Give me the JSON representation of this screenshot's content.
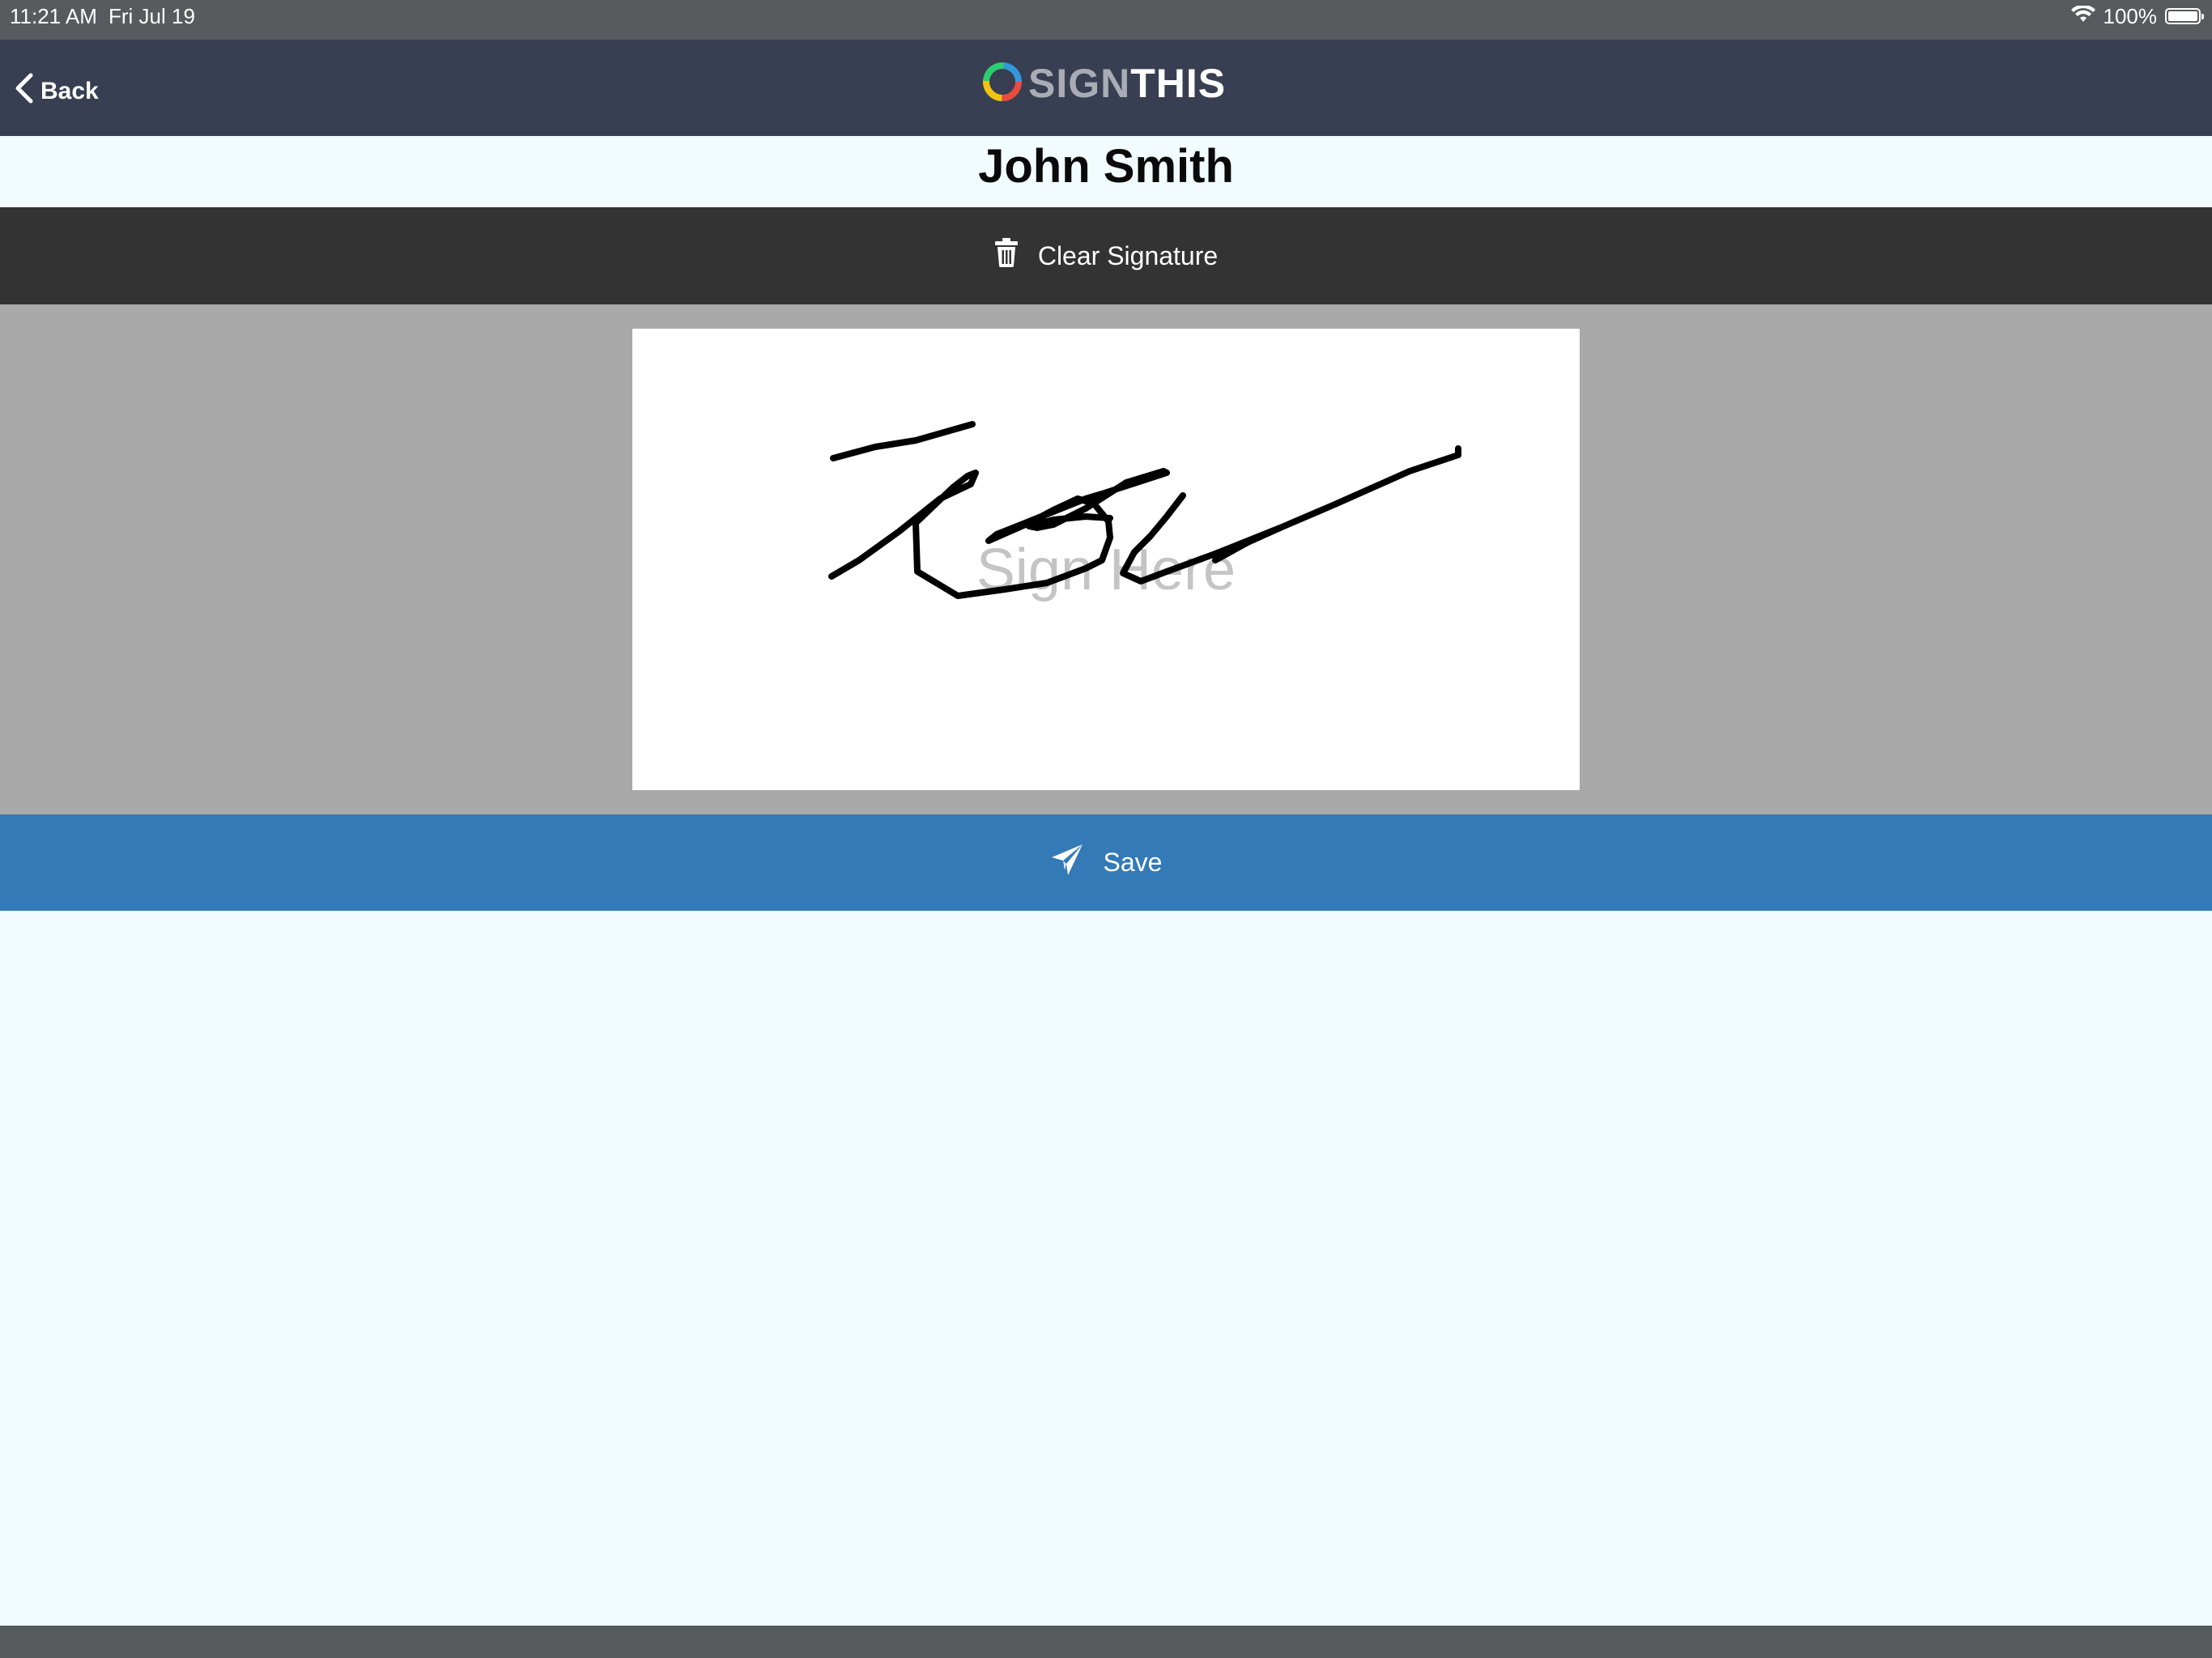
{
  "status_bar": {
    "time": "11:21 AM",
    "date": "Fri Jul 19",
    "battery": "100%",
    "icons": [
      "wifi-icon",
      "battery-icon"
    ]
  },
  "nav": {
    "back_label": "Back",
    "back_icon": "chevron-left-icon",
    "logo_sign": "SIGN",
    "logo_this": "THIS"
  },
  "signer": {
    "name": "John Smith"
  },
  "actions": {
    "clear_label": "Clear Signature",
    "clear_icon": "trash-icon",
    "save_label": "Save",
    "save_icon": "paper-plane-icon"
  },
  "signature_pad": {
    "placeholder": "Sign Here"
  },
  "colors": {
    "status_bar": "#575b5e",
    "nav_bar": "#383f52",
    "clear_bar": "#333333",
    "pad_background": "#a9a9a9",
    "save_bar": "#337ab7",
    "page_background": "#f2fbff"
  }
}
